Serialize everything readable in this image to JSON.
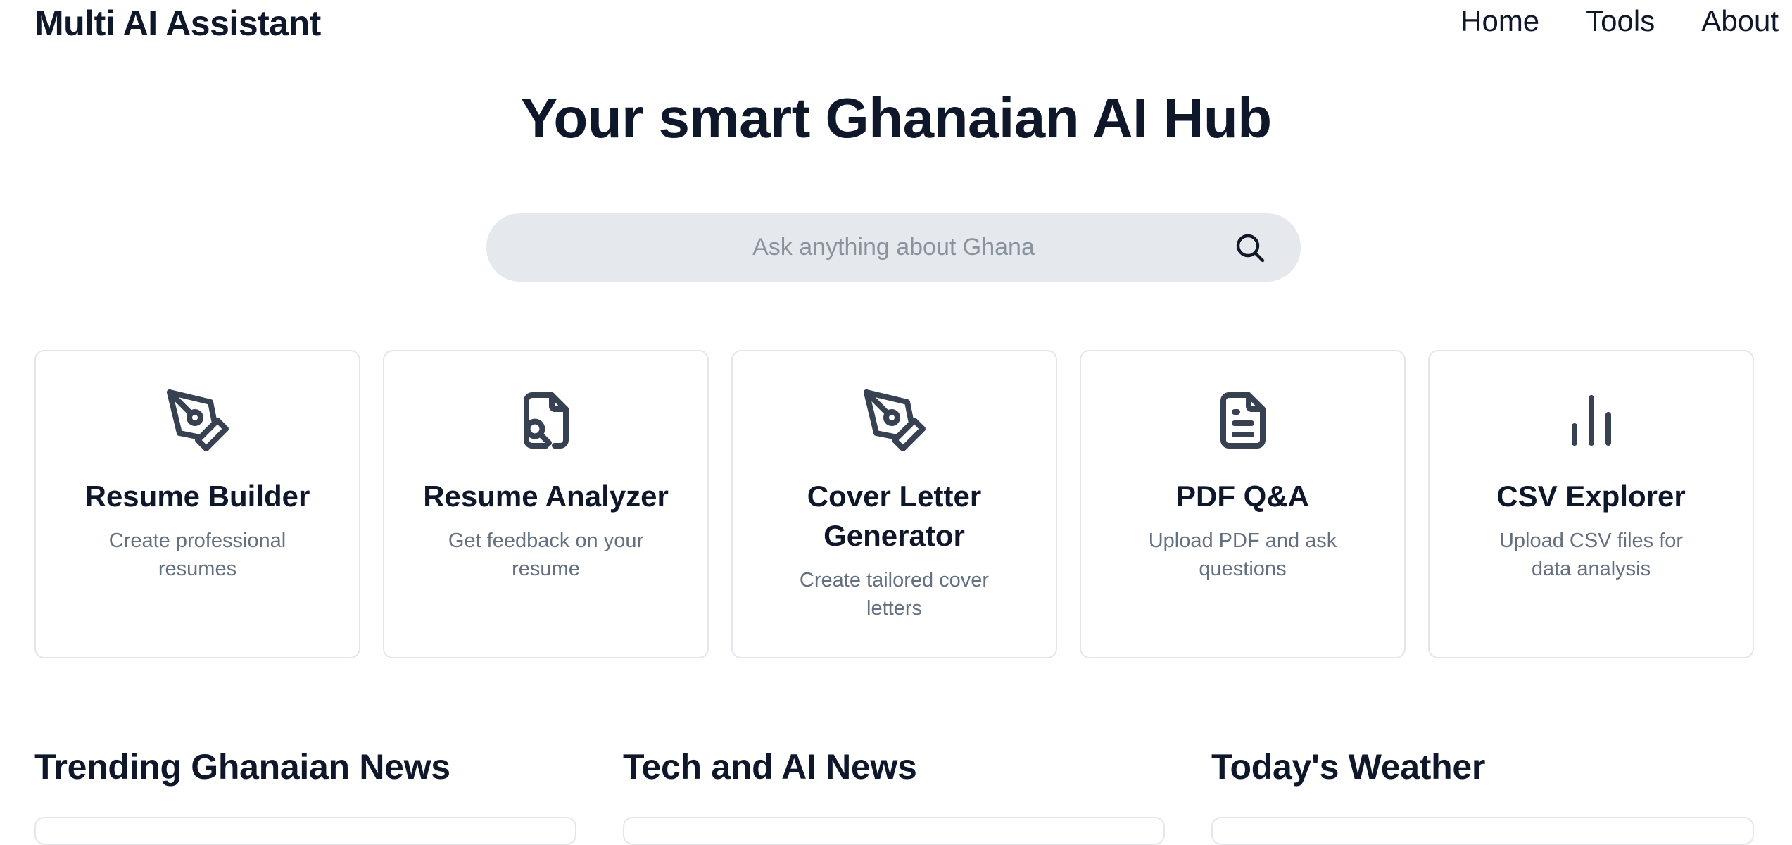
{
  "header": {
    "app_title": "Multi AI Assistant",
    "nav": [
      "Home",
      "Tools",
      "About"
    ]
  },
  "hero": {
    "title": "Your smart Ghanaian AI Hub"
  },
  "search": {
    "value": "",
    "placeholder": "Ask anything about Ghana",
    "icon": "search-icon"
  },
  "tools": [
    {
      "icon": "pen-nib-icon",
      "title": "Resume Builder",
      "description": "Create professional resumes"
    },
    {
      "icon": "file-search-icon",
      "title": "Resume Analyzer",
      "description": "Get feedback on your resume"
    },
    {
      "icon": "pen-nib-icon",
      "title": "Cover Letter Generator",
      "description": "Create tailored cover letters"
    },
    {
      "icon": "document-text-icon",
      "title": "PDF Q&A",
      "description": "Upload PDF and ask questions"
    },
    {
      "icon": "bar-chart-icon",
      "title": "CSV Explorer",
      "description": "Upload CSV files for data analysis"
    }
  ],
  "sections": [
    "Trending Ghanaian News",
    "Tech and AI News",
    "Today's Weather"
  ],
  "colors": {
    "text": "#0f172a",
    "muted": "#64707f",
    "icon": "#374151",
    "search_bg": "#e5e8ec",
    "card_border": "#e3e6ea"
  }
}
